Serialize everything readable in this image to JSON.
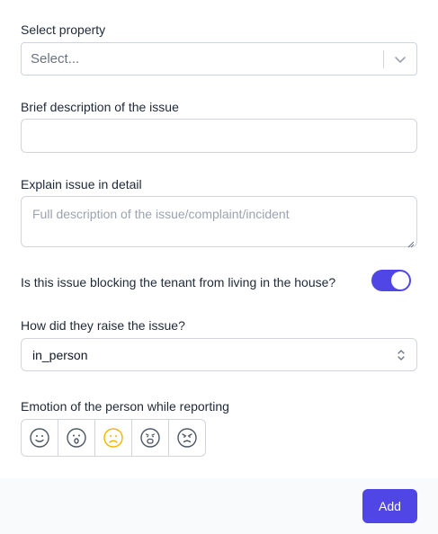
{
  "form": {
    "property_label": "Select property",
    "property_placeholder": "Select...",
    "brief_label": "Brief description of the issue",
    "brief_value": "",
    "detail_label": "Explain issue in detail",
    "detail_placeholder": "Full description of the issue/complaint/incident",
    "blocking_label": "Is this issue blocking the tenant from living in the house?",
    "blocking_on": true,
    "raise_label": "How did they raise the issue?",
    "raise_value": "in_person",
    "emotion_label": "Emotion of the person while reporting",
    "emotions": [
      {
        "icon": "smile-icon",
        "selected": false
      },
      {
        "icon": "surprised-icon",
        "selected": false
      },
      {
        "icon": "frown-icon",
        "selected": true
      },
      {
        "icon": "shocked-icon",
        "selected": false
      },
      {
        "icon": "angry-icon",
        "selected": false
      }
    ]
  },
  "footer": {
    "add_label": "Add"
  },
  "colors": {
    "accent": "#4f46e5",
    "selected_emotion": "#f5b301",
    "footer_bg": "#f9fafb"
  }
}
